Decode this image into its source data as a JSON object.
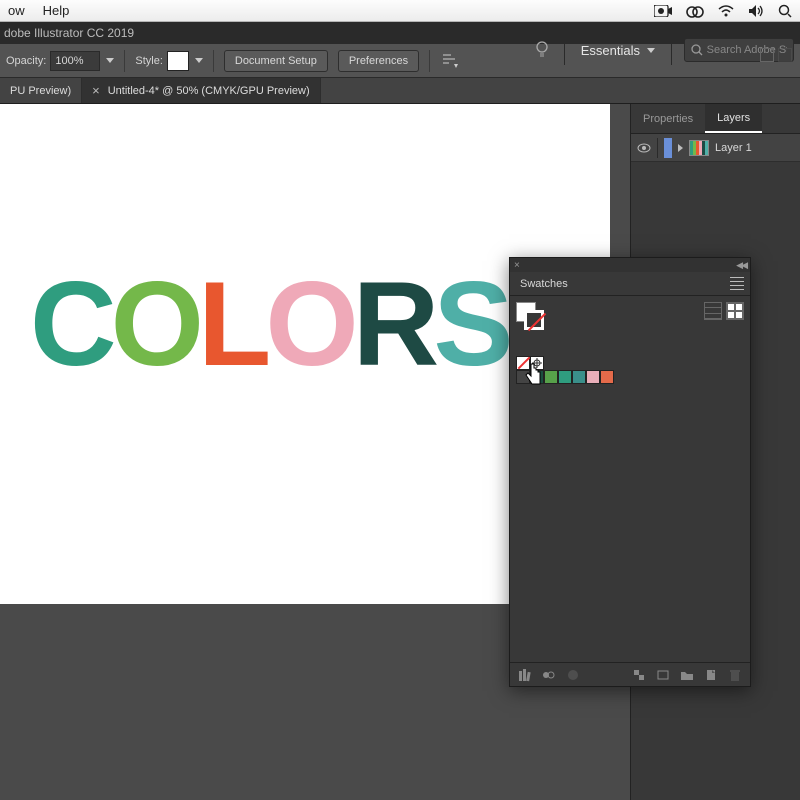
{
  "menubar": {
    "items": [
      "ow",
      "Help"
    ]
  },
  "app": {
    "title": "dobe Illustrator CC 2019"
  },
  "controlbar": {
    "opacity_label": "Opacity:",
    "opacity_value": "100%",
    "style_label": "Style:",
    "doc_setup": "Document Setup",
    "preferences": "Preferences"
  },
  "topright": {
    "workspace": "Essentials",
    "search_placeholder": "Search Adobe St"
  },
  "tabs": [
    {
      "label": "PU Preview)",
      "active": false
    },
    {
      "label": "Untitled-4* @ 50% (CMYK/GPU Preview)",
      "active": true
    }
  ],
  "artwork": {
    "letters": [
      {
        "char": "C",
        "color": "#2f9d7f"
      },
      {
        "char": "O",
        "color": "#74b84a"
      },
      {
        "char": "L",
        "color": "#e8572f"
      },
      {
        "char": "O",
        "color": "#efa9b8"
      },
      {
        "char": "R",
        "color": "#1e4a44"
      },
      {
        "char": "S",
        "color": "#4fafa7"
      }
    ]
  },
  "rightpanel": {
    "tabs": [
      {
        "label": "Properties",
        "active": false
      },
      {
        "label": "Layers",
        "active": true
      }
    ],
    "layer": {
      "name": "Layer 1"
    }
  },
  "swatches": {
    "title": "Swatches",
    "colors": [
      "#1b4d3e",
      "#57a14a",
      "#2f9d7f",
      "#3a8f8a",
      "#e9aeb9",
      "#e46a4a"
    ]
  }
}
